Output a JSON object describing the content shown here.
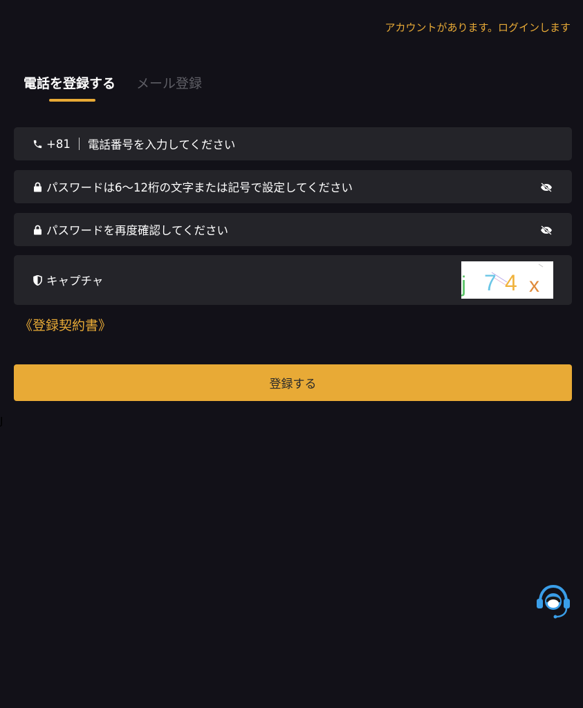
{
  "header": {
    "login_link": "アカウントがあります。ログインします"
  },
  "tabs": [
    {
      "label": "電話を登録する",
      "active": true
    },
    {
      "label": "メール登録",
      "active": false
    }
  ],
  "form": {
    "phone": {
      "country_code": "+81",
      "placeholder": "電話番号を入力してください",
      "icon": "phone-icon"
    },
    "password": {
      "placeholder": "パスワードは6〜12桁の文字または記号で設定してください",
      "icon": "lock-icon",
      "toggle_icon": "eye-off-icon"
    },
    "password_confirm": {
      "placeholder": "パスワードを再度確認してください",
      "icon": "lock-icon",
      "toggle_icon": "eye-off-icon"
    },
    "captcha": {
      "placeholder": "キャプチャ",
      "icon": "shield-icon",
      "image_chars": [
        "j",
        "7",
        "4",
        "x"
      ],
      "image_char_colors": [
        "#5ec46a",
        "#6bc6e6",
        "#f0b23c",
        "#e08a3a"
      ]
    }
  },
  "agreement_link": "《登録契約書》",
  "submit_label": "登録する",
  "stray_text": "J",
  "colors": {
    "background": "#121118",
    "field_background": "#242429",
    "accent": "#e8aa36",
    "inactive_tab": "#5f5f66",
    "support_icon": "#3a9ee8"
  },
  "support_icon": "customer-support-icon"
}
